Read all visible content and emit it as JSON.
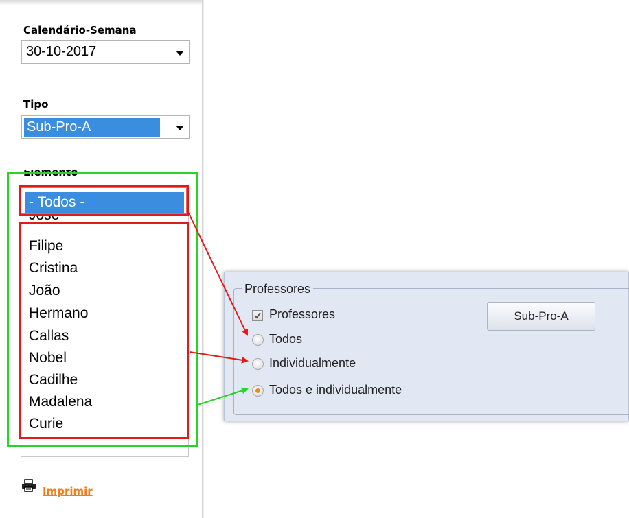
{
  "left": {
    "week_label": "Calendário-Semana",
    "week_value": "30-10-2017",
    "tipo_label": "Tipo",
    "tipo_value": "Sub-Pro-A",
    "elemento_label": "Elemento",
    "elements_selected": "- Todos -",
    "elements_partial": "José",
    "elements": [
      "Filipe",
      "Cristina",
      "João",
      "Hermano",
      "Callas",
      "Nobel",
      "Cadilhe",
      "Madalena",
      "Curie"
    ],
    "print_label": "Imprimir"
  },
  "professores": {
    "group_title": "Professores",
    "checkbox_label": "Professores",
    "checkbox_checked": true,
    "options": [
      "Todos",
      "Individualmente",
      "Todos e individualmente"
    ],
    "selected_option": "Todos e individualmente",
    "button_label": "Sub-Pro-A"
  },
  "colors": {
    "selection_blue": "#3b8de0",
    "highlight_red": "#e31a1a",
    "highlight_green": "#26d626",
    "link_orange": "#ee7d1a",
    "radio_orange": "#e98a1b"
  }
}
